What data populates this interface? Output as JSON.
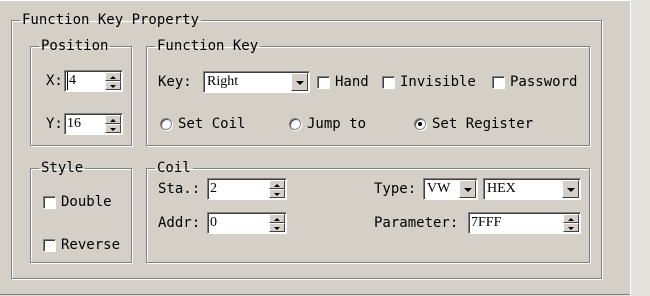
{
  "panel": {
    "title": "Function Key Property"
  },
  "position": {
    "title": "Position",
    "x_label": "X:",
    "x_value": "4",
    "y_label": "Y:",
    "y_value": "16"
  },
  "function_key": {
    "title": "Function Key",
    "key_label": "Key:",
    "key_value": "Right",
    "hand_label": "Hand",
    "invisible_label": "Invisible",
    "password_label": "Password",
    "radios": [
      {
        "label": "Set Coil",
        "selected": false
      },
      {
        "label": "Jump to",
        "selected": false
      },
      {
        "label": "Set Register",
        "selected": true
      }
    ]
  },
  "style": {
    "title": "Style",
    "double_label": "Double",
    "reverse_label": "Reverse"
  },
  "coil": {
    "title": "Coil",
    "sta_label": "Sta.:",
    "sta_value": "2",
    "addr_label": "Addr:",
    "addr_value": "0",
    "type_label": "Type:",
    "type_value": "VW",
    "format_value": "HEX",
    "parameter_label": "Parameter:",
    "parameter_value": "7FFF"
  }
}
